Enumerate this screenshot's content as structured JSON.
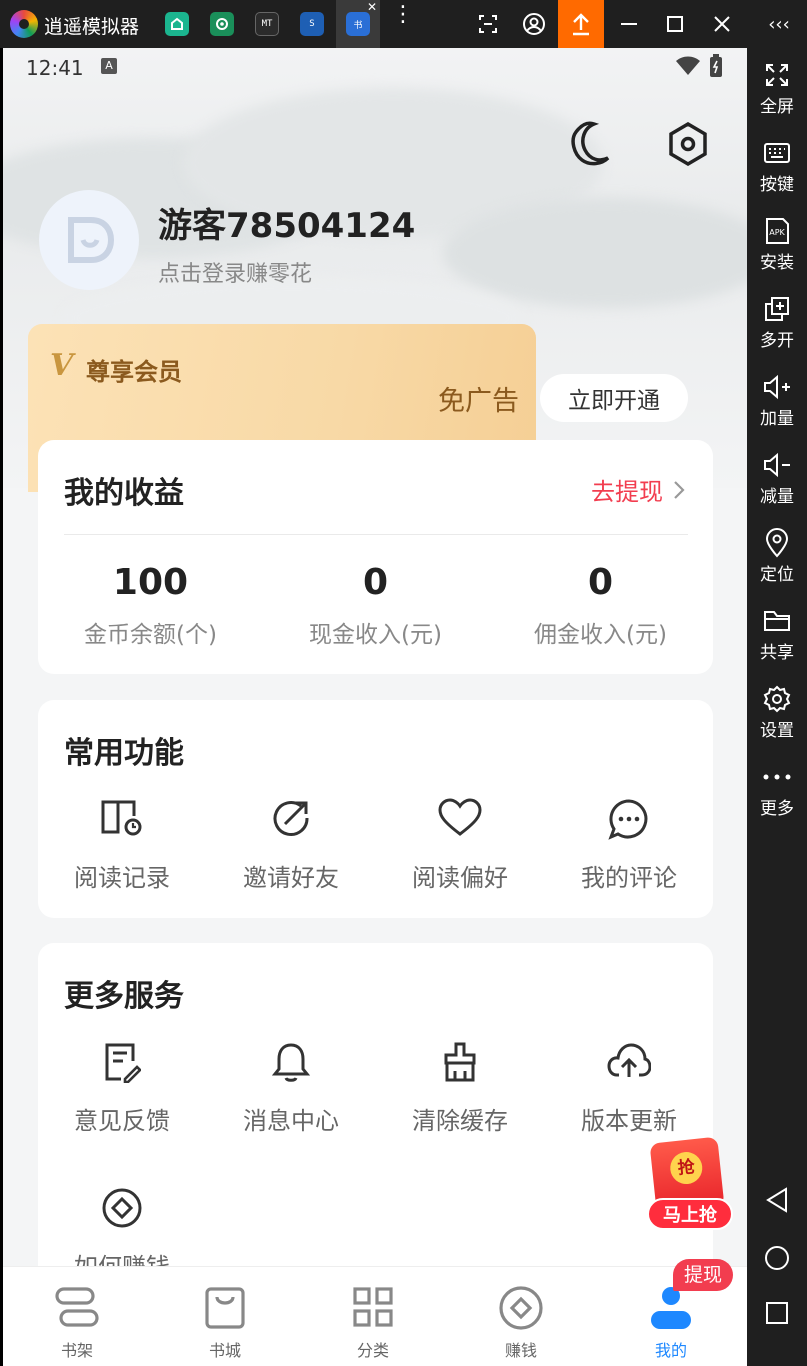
{
  "emulator": {
    "title": "逍遥模拟器",
    "apps": [
      {
        "name": "app-store",
        "color": "#1bb58f",
        "text": ""
      },
      {
        "name": "settings-app",
        "color": "#1a8f5a",
        "text": ""
      },
      {
        "name": "mt-manager",
        "color": "#2b2b2b",
        "text": "MT"
      },
      {
        "name": "s-app",
        "color": "#1e5fb4",
        "text": "S"
      },
      {
        "name": "novel-app",
        "color": "#2a6fd6",
        "text": "书"
      }
    ]
  },
  "status": {
    "time": "12:41"
  },
  "profile": {
    "username": "游客78504124",
    "subtitle": "点击登录赚零花"
  },
  "vip": {
    "title": "尊享会员",
    "feature": "免广告",
    "button": "立即开通"
  },
  "earnings": {
    "title": "我的收益",
    "withdraw": "去提现",
    "stats": [
      {
        "value": "100",
        "label": "金币余额(个)"
      },
      {
        "value": "0",
        "label": "现金收入(元)"
      },
      {
        "value": "0",
        "label": "佣金收入(元)"
      }
    ]
  },
  "common": {
    "title": "常用功能",
    "items": [
      {
        "label": "阅读记录",
        "icon": "book-record-icon"
      },
      {
        "label": "邀请好友",
        "icon": "invite-icon"
      },
      {
        "label": "阅读偏好",
        "icon": "heart-icon"
      },
      {
        "label": "我的评论",
        "icon": "comment-icon"
      }
    ]
  },
  "services": {
    "title": "更多服务",
    "items": [
      {
        "label": "意见反馈",
        "icon": "feedback-icon"
      },
      {
        "label": "消息中心",
        "icon": "bell-icon"
      },
      {
        "label": "清除缓存",
        "icon": "broom-icon"
      },
      {
        "label": "版本更新",
        "icon": "cloud-upload-icon"
      }
    ],
    "extra": {
      "label": "如何赚钱",
      "icon": "coin-icon"
    }
  },
  "promo": {
    "badge": "抢",
    "label": "马上抢"
  },
  "tabs": [
    {
      "label": "书架",
      "icon": "bookshelf-icon"
    },
    {
      "label": "书城",
      "icon": "bag-icon"
    },
    {
      "label": "分类",
      "icon": "grid-icon"
    },
    {
      "label": "赚钱",
      "icon": "coin-icon"
    },
    {
      "label": "我的",
      "icon": "user-icon",
      "active": true
    }
  ],
  "tab_badge": "提现",
  "side_panel": [
    {
      "label": "全屏",
      "icon": "fullscreen-icon"
    },
    {
      "label": "按键",
      "icon": "keyboard-icon"
    },
    {
      "label": "安装",
      "icon": "apk-icon"
    },
    {
      "label": "多开",
      "icon": "multi-instance-icon"
    },
    {
      "label": "加量",
      "icon": "volume-up-icon"
    },
    {
      "label": "减量",
      "icon": "volume-down-icon"
    },
    {
      "label": "定位",
      "icon": "location-icon"
    },
    {
      "label": "共享",
      "icon": "folder-icon"
    },
    {
      "label": "设置",
      "icon": "gear-icon"
    },
    {
      "label": "更多",
      "icon": "more-icon"
    }
  ],
  "colors": {
    "accent": "#f23d4f",
    "active_tab": "#1e88ff",
    "vip_text": "#8b5a1e"
  }
}
